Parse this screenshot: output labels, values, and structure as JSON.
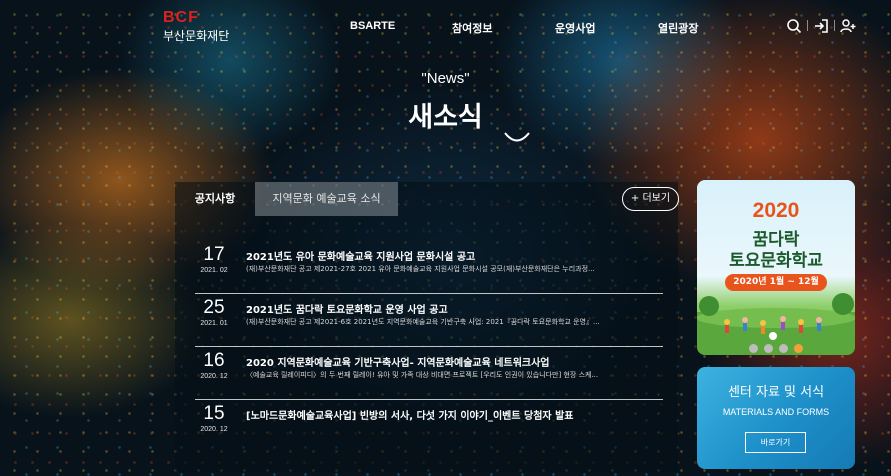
{
  "header": {
    "logo_mark": "BCF",
    "logo_text": "부산문화재단",
    "nav": [
      "BSARTE",
      "참여정보",
      "운영사업",
      "열린광장"
    ],
    "icons": [
      "search-icon",
      "login-icon",
      "add-user-icon"
    ]
  },
  "hero": {
    "title_en": "\"News\"",
    "title_ko": "새소식"
  },
  "tabs": {
    "notice": "공지사항",
    "regional": "지역문화 예술교육 소식"
  },
  "more_label": "+ 더보기",
  "news": [
    {
      "day": "17",
      "ym": "2021. 02",
      "title": "2021년도 유아 문화예술교육 지원사업 문화시설 공고",
      "summary": "(재)부산문화재단 공고 제2021-27호 2021 유아 문화예술교육 지원사업 문화시설 공모(재)부산문화재단은 누리과정..."
    },
    {
      "day": "25",
      "ym": "2021. 01",
      "title": "2021년도 꿈다락 토요문화학교 운영 사업 공고",
      "summary": "(재)부산문화재단 공고 제2021-6호 2021년도 지역문화예술교육 기반구축 사업: 2021『꿈다락 토요문화학교 운영』..."
    },
    {
      "day": "16",
      "ym": "2020. 12",
      "title": "2020 지역문화예술교육 기반구축사업- 지역문화예술교육 네트워크사업",
      "summary": "〈예술교육 릴레이피디〉의 두 번째 릴레이! 유아 및 가족 대상 비대면 프로젝트 [우리도 인권이 있습니다만] 현장 스케..."
    },
    {
      "day": "15",
      "ym": "2020. 12",
      "title": "[노마드문화예술교육사업] 빈방의 서사, 다섯 가지 이야기_이벤트 당첨자 발표",
      "summary": ""
    }
  ],
  "banner": {
    "year": "2020",
    "line1": "꿈다락",
    "line2": "토요문화학교",
    "date": "2020년 1월 ~ 12월",
    "slides": 4,
    "active_slide": 4
  },
  "resources": {
    "title": "센터 자료 및 서식",
    "subtitle": "MATERIALS AND FORMS",
    "button": "바로가기"
  },
  "colors": {
    "logo_red": "#e0201a",
    "banner_orange": "#e8541c",
    "banner_green": "#1a5a2c",
    "resources_blue": "#1d8fc9"
  }
}
